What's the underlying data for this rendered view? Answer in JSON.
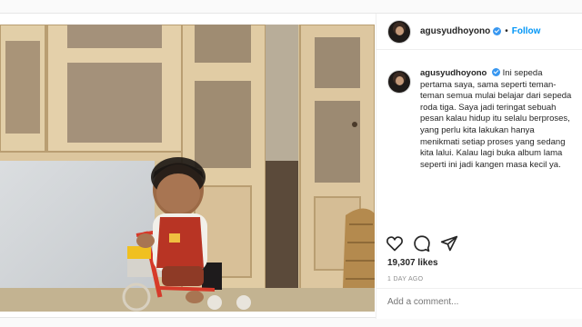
{
  "post": {
    "username": "agusyudhoyono",
    "follow_label": "Follow",
    "dot": "•",
    "caption": "Ini sepeda pertama saya, sama seperti teman-teman semua mulai belajar dari sepeda roda tiga. Saya jadi teringat sebuah pesan kalau hidup itu selalu berproses, yang perlu kita lakukan hanya menikmati setiap proses yang sedang kita lalui. Kalau lagi buka album lama seperti ini jadi kangen masa kecil ya.",
    "likes": "19,307 likes",
    "time": "1 DAY AGO",
    "comment_placeholder": "Add a comment...",
    "photo_alt": "Child on a tricycle"
  },
  "icons": [
    "heart-icon",
    "comment-icon",
    "share-icon"
  ],
  "colors": {
    "link": "#0095f6",
    "verified": "#3897f0",
    "muted": "#8e8e8e"
  }
}
